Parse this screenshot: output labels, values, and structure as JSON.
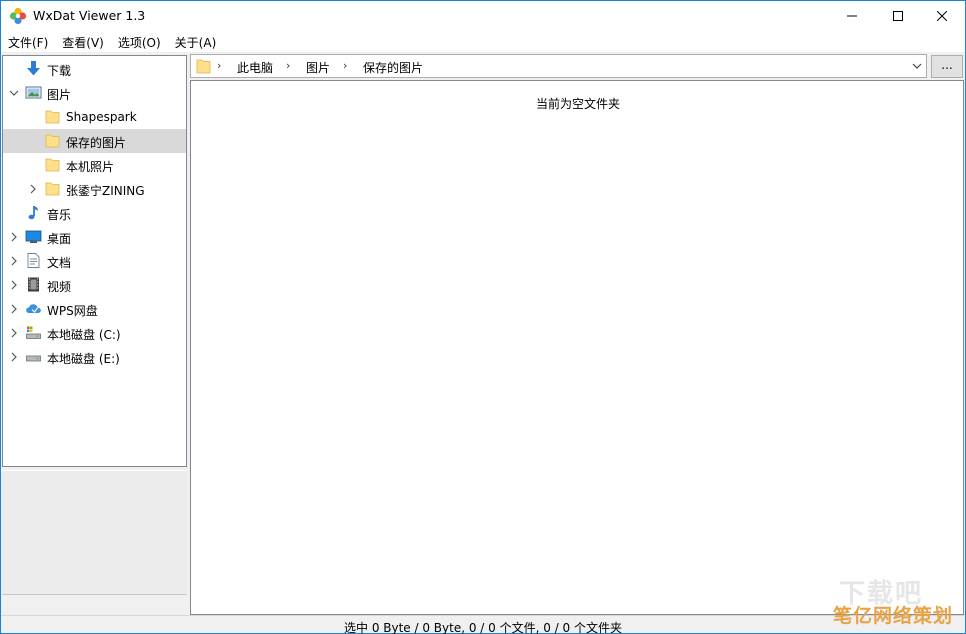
{
  "app": {
    "title": "WxDat Viewer 1.3"
  },
  "window_controls": {
    "minimize_icon": "minimize-icon",
    "maximize_icon": "maximize-icon",
    "close_icon": "close-icon"
  },
  "menu": {
    "items": [
      "文件(F)",
      "查看(V)",
      "选项(O)",
      "关于(A)"
    ]
  },
  "tree": {
    "items": [
      {
        "label": "下载",
        "icon": "download-arrow-icon",
        "expander": "none",
        "level": 0
      },
      {
        "label": "图片",
        "icon": "pictures-icon",
        "expander": "expanded",
        "level": 0
      },
      {
        "label": "Shapespark",
        "icon": "folder-icon",
        "expander": "none",
        "level": 1
      },
      {
        "label": "保存的图片",
        "icon": "folder-icon",
        "expander": "none",
        "level": 1,
        "selected": true
      },
      {
        "label": "本机照片",
        "icon": "folder-icon",
        "expander": "none",
        "level": 1
      },
      {
        "label": "张鋈宁ZINING",
        "icon": "folder-icon",
        "expander": "collapsed",
        "level": 1
      },
      {
        "label": "音乐",
        "icon": "music-note-icon",
        "expander": "none",
        "level": 0
      },
      {
        "label": "桌面",
        "icon": "desktop-icon",
        "expander": "collapsed",
        "level": 0
      },
      {
        "label": "文档",
        "icon": "document-icon",
        "expander": "collapsed",
        "level": 0
      },
      {
        "label": "视频",
        "icon": "video-icon",
        "expander": "collapsed",
        "level": 0
      },
      {
        "label": "WPS网盘",
        "icon": "cloud-drive-icon",
        "expander": "collapsed",
        "level": 0
      },
      {
        "label": "本地磁盘 (C:)",
        "icon": "system-drive-icon",
        "expander": "collapsed",
        "level": 0
      },
      {
        "label": "本地磁盘 (E:)",
        "icon": "drive-icon",
        "expander": "collapsed",
        "level": 0
      }
    ]
  },
  "address": {
    "crumbs": [
      "此电脑",
      "图片",
      "保存的图片"
    ],
    "separator": "›",
    "more_label": "..."
  },
  "content": {
    "empty_message": "当前为空文件夹"
  },
  "status": {
    "text": "选中 0 Byte / 0 Byte, 0 / 0 个文件, 0 / 0 个文件夹"
  },
  "watermark": {
    "line1": "下载吧",
    "line2": "笔亿网络策划"
  },
  "colors": {
    "selection": "#d9d9d9",
    "folder": "#ffe08a",
    "accent": "#1883d7",
    "watermark": "#e9a347"
  }
}
